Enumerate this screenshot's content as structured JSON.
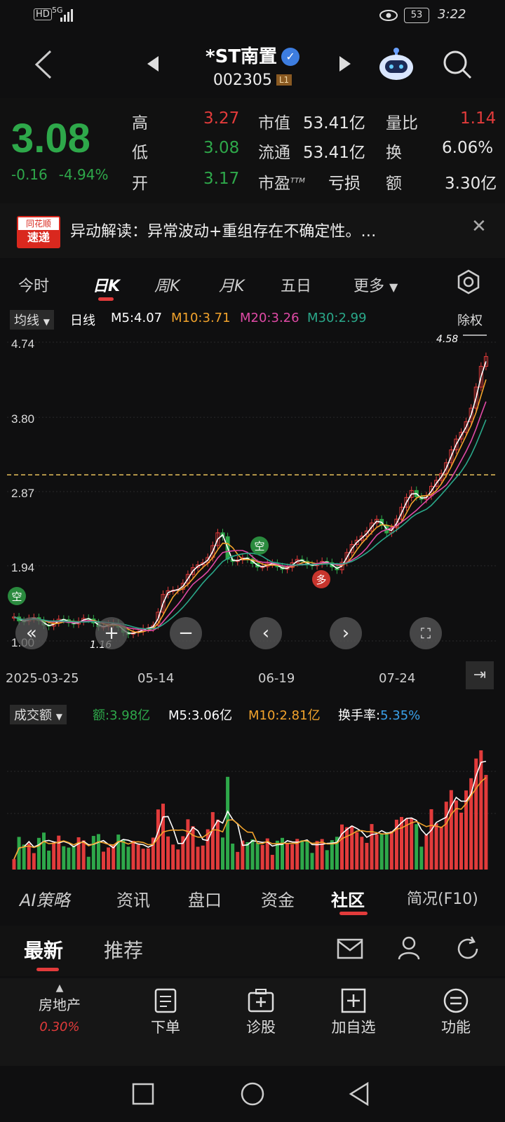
{
  "status": {
    "hd": "HD",
    "net": "5G",
    "battery": "53",
    "time": "3:22"
  },
  "header": {
    "name": "*ST南置",
    "code": "002305",
    "level": "L1"
  },
  "quote": {
    "price": "3.08",
    "change": "-0.16",
    "change_pct": "-4.94%",
    "high_label": "高",
    "high": "3.27",
    "low_label": "低",
    "low": "3.08",
    "open_label": "开",
    "open": "3.17",
    "mktcap_label": "市值",
    "mktcap": "53.41亿",
    "float_label": "流通",
    "float": "53.41亿",
    "pe_label": "市盈",
    "pe_sup": "TTM",
    "pe": "亏损",
    "vr_label": "量比",
    "vr": "1.14",
    "turn_label": "换",
    "turn": "6.06%",
    "amt_label": "额",
    "amt": "3.30亿"
  },
  "news": {
    "logo_top": "同花顺",
    "logo_bottom": "速递",
    "text": "异动解读：异常波动+重组存在不确定性。…"
  },
  "tabs": [
    "今时",
    "日K",
    "周K",
    "月K",
    "五日",
    "更多"
  ],
  "ma_legend": {
    "selector": "均线",
    "period": "日线",
    "m5": "M5:4.07",
    "m10": "M10:3.71",
    "m20": "M20:3.26",
    "m30": "M30:2.99",
    "adjust": "除权"
  },
  "chart_data": {
    "type": "candlestick",
    "y_labels": [
      "4.74",
      "3.80",
      "2.87",
      "1.94",
      "1.00"
    ],
    "ylim": [
      1.0,
      4.74
    ],
    "x_labels": [
      "2025-03-25",
      "05-14",
      "06-19",
      "07-24"
    ],
    "current_price_line": 3.08,
    "max_marker": "4.58",
    "min_marker": "1.16",
    "signal_labels": [
      "空",
      "多"
    ],
    "colors": {
      "up": "#e23b3b",
      "down": "#2ea84a",
      "m5": "#ffffff",
      "m10": "#f2a32c",
      "m20": "#e04aa6",
      "m30": "#2aa88a"
    }
  },
  "volume": {
    "selector": "成交额",
    "amount": "额:3.98亿",
    "m5": "M5:3.06亿",
    "m10": "M10:2.81亿",
    "turn_label": "换手率:",
    "turn_value": "5.35%"
  },
  "bottom_tabs": [
    "AI策略",
    "资讯",
    "盘口",
    "资金",
    "社区",
    "简况(F10)"
  ],
  "community": {
    "latest": "最新",
    "recommend": "推荐"
  },
  "dock": {
    "sector": "房地产",
    "sector_pct": "0.30%",
    "order": "下单",
    "diagnose": "诊股",
    "add": "加自选",
    "func": "功能"
  }
}
